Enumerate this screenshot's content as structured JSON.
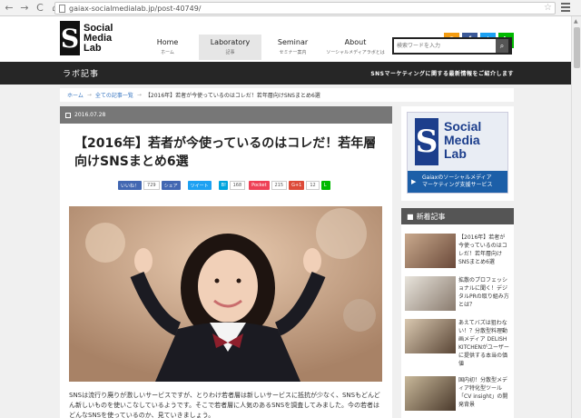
{
  "browser": {
    "url": "gaiax-socialmedialab.jp/post-40749/",
    "back": "←",
    "forward": "→",
    "reload": "C",
    "home": "⌂"
  },
  "header": {
    "logo_letter": "S",
    "logo_line1": "Social",
    "logo_line2": "Media",
    "logo_line3": "Lab",
    "nav": [
      {
        "label": "Home",
        "sub": "ホーム"
      },
      {
        "label": "Laboratory",
        "sub": "記事"
      },
      {
        "label": "Seminar",
        "sub": "セミナー案内"
      },
      {
        "label": "About",
        "sub": "ソーシャルメディアラボとは"
      }
    ],
    "social": [
      {
        "icon": "rss-icon",
        "glyph": "◉",
        "color": "#f39c12"
      },
      {
        "icon": "facebook-icon",
        "glyph": "f",
        "color": "#3b5998"
      },
      {
        "icon": "twitter-icon",
        "glyph": "t",
        "color": "#1da1f2"
      },
      {
        "icon": "line-icon",
        "glyph": "L",
        "color": "#00b900"
      }
    ],
    "search_placeholder": "検索ワードを入力",
    "search_glyph": "⌕"
  },
  "band": {
    "title": "ラボ記事",
    "tagline": "SNSマーケティングに関する最新情報をご紹介します"
  },
  "breadcrumb": {
    "home": "ホーム",
    "sep": "→",
    "list": "全ての記事一覧",
    "current": "【2016年】若者が今使っているのはコレだ！若年層向けSNSまとめ6選"
  },
  "article": {
    "date": "2016.07.28",
    "title": "【2016年】若者が今使っているのはコレだ！若年層向けSNSまとめ6選",
    "share": {
      "like": "いいね！",
      "like_count": "729",
      "fb_share": "シェア",
      "tweet": "ツイート",
      "hatena_count": "168",
      "pocket": "Pocket",
      "pocket_count": "215",
      "gplus": "G+1",
      "gplus_count": "12"
    },
    "body": "SNSは流行り廃りが激しいサービスですが、とりわけ若者層は新しいサービスに抵抗が少なく、SNSもどんどん新しいものを使いこなしているようです。そこで若者層に人気のあるSNSを調査してみました。今の若者はどんなSNSを使っているのか、見ていきましょう。"
  },
  "sidebar": {
    "ad_letter": "S",
    "ad_line1": "Social",
    "ad_line2": "Media",
    "ad_line3": "Lab",
    "ad_band_line1": "Gaiaxのソーシャルメディア",
    "ad_band_line2": "マーケティング支援サービス",
    "new_heading": "新着記事",
    "items": [
      {
        "text": "【2016年】若者が今使っているのはコレだ！若年層向けSNSまとめ6選"
      },
      {
        "text": "拡散のプロフェッショナルに聞く！デジタルPRの取り組み方とは？"
      },
      {
        "text": "あえてバズは狙わない！？分散型料理動画メディア DELISH KITCHENがユーザーに提供する本当の価値"
      },
      {
        "text": "国内初！分散型メディア特化型ツール「CV insight」の開発背景"
      }
    ]
  }
}
